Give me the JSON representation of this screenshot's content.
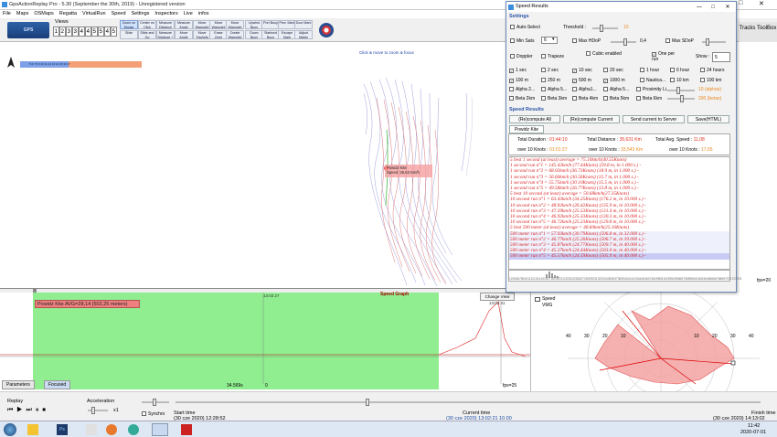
{
  "window": {
    "title": "GpsActionReplay Pro - 5.30  (September the 30th, 2019) - Unregistered version"
  },
  "menu": [
    "File",
    "Maps",
    "OSMaps",
    "Regatta",
    "VirtualRun",
    "Speed",
    "Settings",
    "Inspectors",
    "Live",
    "infos"
  ],
  "toolbar": {
    "logo": "GPS",
    "views_label": "Views",
    "views": [
      "1",
      "2",
      "3",
      "3",
      "4",
      "4",
      "5",
      "5"
    ],
    "buttons": [
      {
        "label": "Zoom on Mouse"
      },
      {
        "label": "Center on Click"
      },
      {
        "label": "Measure Distance"
      },
      {
        "label": "Measure Angle"
      },
      {
        "label": "Move Waypoint"
      },
      {
        "label": "Move Waypoint"
      },
      {
        "label": "Upwind Buoy"
      },
      {
        "label": "Port Buoy"
      },
      {
        "label": "Prev. Mark"
      },
      {
        "label": "Door Mark"
      }
    ],
    "buttons2": [
      {
        "label": "Slide"
      },
      {
        "label": "Slide and Go"
      },
      {
        "label": "Measure Distance + Dist"
      },
      {
        "label": "Move Angle"
      },
      {
        "label": "Move Trackpts"
      },
      {
        "label": "Erase Zone"
      },
      {
        "label": "Create Waypoint"
      },
      {
        "label": "Down Buoy"
      },
      {
        "label": "Starbord Buoy"
      },
      {
        "label": "Escape Mark"
      },
      {
        "label": "Adjust Marks"
      }
    ],
    "tracks_toolbox": "Tracks ToolBox"
  },
  "map": {
    "click_zoom": "Click & move to zoom & focus",
    "marker_name": "Powidz Kite",
    "marker_speed": "Speed: 26,62 Km/h",
    "fps": "fps=20"
  },
  "graph": {
    "title": "Speed Graph",
    "avg_label": "Powidz Kite AVG=28,14 (502,25 meters)",
    "change_button": "Change View",
    "time_left": "13:02:27",
    "time_right": "13:02:41",
    "duration": "34.569s",
    "zero": "0",
    "fps": "fps=25",
    "tabs": [
      "Parameters",
      "Focused"
    ]
  },
  "polar": {
    "legend": [
      "Speed",
      "VMG"
    ],
    "rings": [
      "40",
      "30",
      "20",
      "10",
      "10",
      "20",
      "30",
      "40"
    ]
  },
  "replay": {
    "label": "Replay",
    "acceleration": "Acceleration",
    "accel_value": "x1",
    "synchro": "Synchro",
    "start_label": "Start time",
    "start_value": "(30 cze 2020) 12:28:52",
    "current_label": "Current time",
    "current_value": "(30 cze 2020) 13:02:21",
    "current_value2": "10.00",
    "finish_label": "Finish time",
    "finish_value": "(30 cze 2020) 14:13:02"
  },
  "taskbar": {
    "time": "11:42",
    "date": "2020-07-01"
  },
  "dialog": {
    "title": "Speed Results",
    "settings_label": "Settings",
    "auto_select": "Auto-Select",
    "threshold_label": "Threshold :",
    "threshold_value": "10",
    "min_sats": "Min Sats",
    "min_sats_value": "6",
    "max_hdop": "Max HDoP",
    "max_hdop_value": "0,4",
    "max_sdop": "Max SDoP",
    "doppler": "Doppler",
    "trapeze": "Trapeze",
    "cubic": "Cubic enabled",
    "one_per_run": "One per run",
    "show_label": "Show :",
    "show_value": "5",
    "rows": [
      [
        {
          "l": "1 sec",
          "on": true
        },
        {
          "l": "2 sec",
          "on": false
        },
        {
          "l": "10 sec",
          "on": true
        },
        {
          "l": "20 sec",
          "on": false
        },
        {
          "l": "1 hour",
          "on": false
        },
        {
          "l": "6 hour",
          "on": false
        },
        {
          "l": "24 hours",
          "on": false
        }
      ],
      [
        {
          "l": "100 m",
          "on": true
        },
        {
          "l": "250 m",
          "on": false
        },
        {
          "l": "500 m",
          "on": true
        },
        {
          "l": "1000 m",
          "on": true
        },
        {
          "l": "Nautica...",
          "on": false
        },
        {
          "l": "10 km",
          "on": false
        },
        {
          "l": "100 km",
          "on": false
        }
      ],
      [
        {
          "l": "Alpha 2...",
          "on": false
        },
        {
          "l": "Alpha 5...",
          "on": false
        },
        {
          "l": "Alpha1...",
          "on": false
        },
        {
          "l": "Alpha 5...",
          "on": false
        },
        {
          "l": "Proximity Li...",
          "on": false
        }
      ],
      [
        {
          "l": "Beta 2km",
          "on": false
        },
        {
          "l": "Beta 3km",
          "on": false
        },
        {
          "l": "Beta 4km",
          "on": false
        },
        {
          "l": "Beta 5km",
          "on": false
        },
        {
          "l": "Beta 6km",
          "on": false
        }
      ]
    ],
    "proximity_value": "10 (alphas)",
    "beta_value": "200 (betas)",
    "results_label": "Speed Results",
    "buttons": [
      "(Re)compute All",
      "(Re)compute Current",
      "Send current to Server",
      "Save(HTML)"
    ],
    "tab": "Powidz Kite",
    "totals": {
      "duration_label": "Total Duration :",
      "duration_value": "01:44:10",
      "distance_label": "Total Distance :",
      "distance_value": "35,631 Km",
      "avg_label": "Total Avg. Speed :",
      "avg_value": "11,08",
      "over1_label": "over 10 Knots :",
      "over1_value": "01:01:27",
      "over2_label": "over 10 Knots :",
      "over2_value": "33,543 Km",
      "over3_label": "over 10 Knots :",
      "over3_value": "17,65"
    },
    "results": [
      {
        "t": "5 best 1 second (at least) average = 75.10km/h(40.55Knots)",
        "c": "hdr"
      },
      {
        "t": "1 second run n°1 = 145.42km/h (77.44Knots) (59.8 m, in 1.000 s.) -",
        "c": ""
      },
      {
        "t": "1 second run n°2 = 68.02km/h (36.73Knots) (18.9 m, in 1.000 s.) -",
        "c": ""
      },
      {
        "t": "1 second run n°3 = 56.60km/h (30.56Knots) (15.7 m, in 1.000 s.) -",
        "c": ""
      },
      {
        "t": "1 second run n°4 = 55.75km/h (30.10Knots) (15.5 m, in 1.000 s.) -",
        "c": ""
      },
      {
        "t": "1 second run n°5 = 49.58km/h (26.77Knots) (13.8 m, in 1.000 s.) -",
        "c": ""
      },
      {
        "t": "5 best 10 second (at least) average = 50.68km/h(27.35Knots)",
        "c": "hdr"
      },
      {
        "t": "10 second run n°1 = 63.43km/h (34.25Knots) (176.2 m, in 10.000 s.) -",
        "c": ""
      },
      {
        "t": "10 second run n°2 = 48.92km/h (26.42Knots) (135.9 m, in 10.000 s.) -",
        "c": ""
      },
      {
        "t": "10 second run n°3 = 47.29km/h (25.53Knots) (131.4 m, in 10.000 s.) -",
        "c": ""
      },
      {
        "t": "10 second run n°4 = 46.92km/h (25.33Knots) (130.3 m, in 10.000 s.) -",
        "c": ""
      },
      {
        "t": "10 second run n°5 = 46.72km/h (25.23Knots) (129.8 m, in 10.000 s.) -",
        "c": ""
      },
      {
        "t": "5 best 500 meter (at least) average = 46.60km/h(25.16Knots)",
        "c": "hdr"
      },
      {
        "t": "500 meter run n°1 = 57.03km/h (30.79Knots) (506.8 m, in 32.000 s.) -",
        "c": "alt"
      },
      {
        "t": "500 meter run n°2 = 46.77km/h (25.26Knots) (506.7 m, in 39.000 s.) -",
        "c": "alt"
      },
      {
        "t": "500 meter run n°3 = 45.87km/h (24.77Knots) (509.7 m, in 40.000 s.) -",
        "c": "alt"
      },
      {
        "t": "500 meter run n°4 = 45.27km/h (24.44Knots) (503.0 m, in 40.000 s.) -",
        "c": "alt"
      },
      {
        "t": "500 meter run n°5 = 45.57km/h (24.59Knots) (505.9 m, in 40.000 s.) -",
        "c": "sel2"
      }
    ],
    "histo_labels": "1234567891011121314151617181920212223242526272829303132333435363738394041424344454647484950515253545556575859606162636465666768697071727374"
  }
}
